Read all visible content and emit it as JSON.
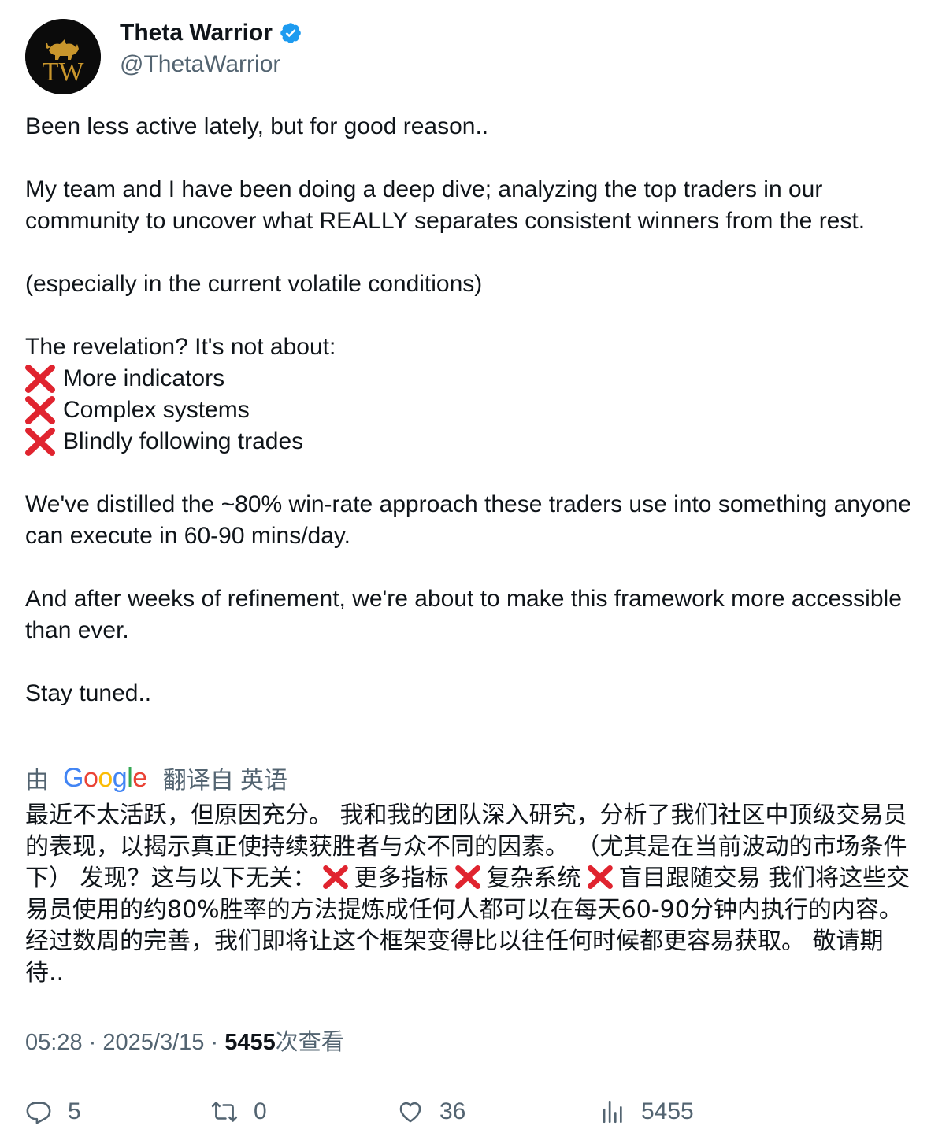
{
  "author": {
    "name": "Theta Warrior",
    "handle": "@ThetaWarrior",
    "avatar_monogram": "TW",
    "verified_icon": "verified-badge-icon",
    "verified_color": "#1d9bf0"
  },
  "tweet": {
    "paragraphs": [
      "Been less active lately, but for good reason..",
      "My team and I have been doing a deep dive; analyzing the top traders in our community to uncover what REALLY separates consistent winners from the rest.",
      "(especially in the current volatile conditions)",
      "The revelation? It's not about:"
    ],
    "x_items": [
      "More indicators",
      "Complex systems",
      "Blindly following trades"
    ],
    "paragraphs_after": [
      "We've distilled the ~80% win-rate approach these traders use into something anyone can execute in 60-90 mins/day.",
      "And after weeks of refinement, we're about to make this framework more accessible than ever.",
      "Stay tuned.."
    ],
    "x_icon": "cross-mark-icon",
    "x_color": "#e0242f"
  },
  "translation": {
    "by_label": "由",
    "provider": "Google",
    "translated_from_label": "翻译自 英语",
    "parts": [
      "最近不太活跃，但原因充分。 我和我的团队深入研究，分析了我们社区中顶级交易员的表现，以揭示真正使持续获胜者与众不同的因素。 （尤其是在当前波动的市场条件下） 发现？这与以下无关：",
      "更多指标",
      "复杂系统",
      "盲目跟随交易 我们将这些交易员使用的约80%胜率的方法提炼成任何人都可以在每天60-90分钟内执行的内容。 经过数周的完善，我们即将让这个框架变得比以往任何时候都更容易获取。 敬请期待.."
    ]
  },
  "meta": {
    "time": "05:28",
    "separator": "·",
    "date": "2025/3/15",
    "views_count": "5455",
    "views_label": "次查看"
  },
  "actions": {
    "reply_count": "5",
    "repost_count": "0",
    "like_count": "36",
    "views_count": "5455",
    "icon_color": "#536471"
  },
  "google_colors": [
    "#4285F4",
    "#EA4335",
    "#FBBC05",
    "#4285F4",
    "#34A853",
    "#EA4335"
  ]
}
